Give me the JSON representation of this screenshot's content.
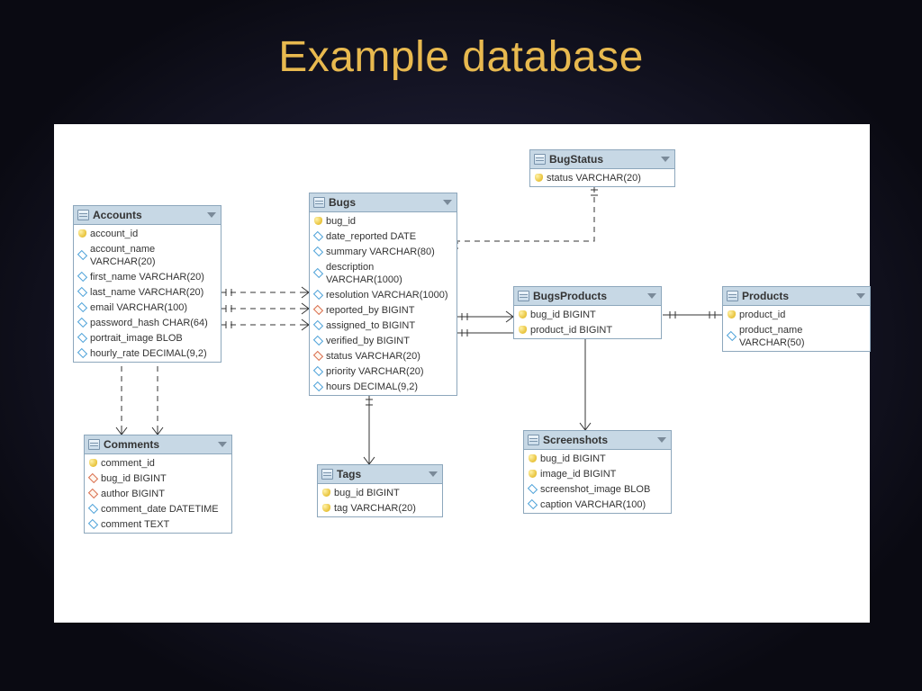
{
  "title": "Example database",
  "tables": {
    "accounts": {
      "name": "Accounts",
      "fields": [
        {
          "icon": "key",
          "label": "account_id"
        },
        {
          "icon": "col",
          "label": "account_name VARCHAR(20)"
        },
        {
          "icon": "col",
          "label": "first_name VARCHAR(20)"
        },
        {
          "icon": "col",
          "label": "last_name VARCHAR(20)"
        },
        {
          "icon": "col",
          "label": "email VARCHAR(100)"
        },
        {
          "icon": "col",
          "label": "password_hash CHAR(64)"
        },
        {
          "icon": "col",
          "label": "portrait_image BLOB"
        },
        {
          "icon": "col",
          "label": "hourly_rate DECIMAL(9,2)"
        }
      ]
    },
    "bugs": {
      "name": "Bugs",
      "fields": [
        {
          "icon": "key",
          "label": "bug_id"
        },
        {
          "icon": "col",
          "label": "date_reported DATE"
        },
        {
          "icon": "col",
          "label": "summary VARCHAR(80)"
        },
        {
          "icon": "col",
          "label": "description VARCHAR(1000)"
        },
        {
          "icon": "col",
          "label": "resolution VARCHAR(1000)"
        },
        {
          "icon": "fk",
          "label": "reported_by BIGINT"
        },
        {
          "icon": "col",
          "label": "assigned_to BIGINT"
        },
        {
          "icon": "col",
          "label": "verified_by BIGINT"
        },
        {
          "icon": "fk",
          "label": "status VARCHAR(20)"
        },
        {
          "icon": "col",
          "label": "priority VARCHAR(20)"
        },
        {
          "icon": "col",
          "label": "hours DECIMAL(9,2)"
        }
      ]
    },
    "bugstatus": {
      "name": "BugStatus",
      "fields": [
        {
          "icon": "key",
          "label": "status VARCHAR(20)"
        }
      ]
    },
    "bugsproducts": {
      "name": "BugsProducts",
      "fields": [
        {
          "icon": "key",
          "label": "bug_id BIGINT"
        },
        {
          "icon": "key",
          "label": "product_id BIGINT"
        }
      ]
    },
    "products": {
      "name": "Products",
      "fields": [
        {
          "icon": "key",
          "label": "product_id"
        },
        {
          "icon": "col",
          "label": "product_name VARCHAR(50)"
        }
      ]
    },
    "comments": {
      "name": "Comments",
      "fields": [
        {
          "icon": "key",
          "label": "comment_id"
        },
        {
          "icon": "fk",
          "label": "bug_id BIGINT"
        },
        {
          "icon": "fk",
          "label": "author BIGINT"
        },
        {
          "icon": "col",
          "label": "comment_date DATETIME"
        },
        {
          "icon": "col",
          "label": "comment TEXT"
        }
      ]
    },
    "tags": {
      "name": "Tags",
      "fields": [
        {
          "icon": "key",
          "label": "bug_id BIGINT"
        },
        {
          "icon": "key",
          "label": "tag VARCHAR(20)"
        }
      ]
    },
    "screenshots": {
      "name": "Screenshots",
      "fields": [
        {
          "icon": "key",
          "label": "bug_id BIGINT"
        },
        {
          "icon": "key",
          "label": "image_id BIGINT"
        },
        {
          "icon": "col",
          "label": "screenshot_image BLOB"
        },
        {
          "icon": "col",
          "label": "caption VARCHAR(100)"
        }
      ]
    }
  }
}
